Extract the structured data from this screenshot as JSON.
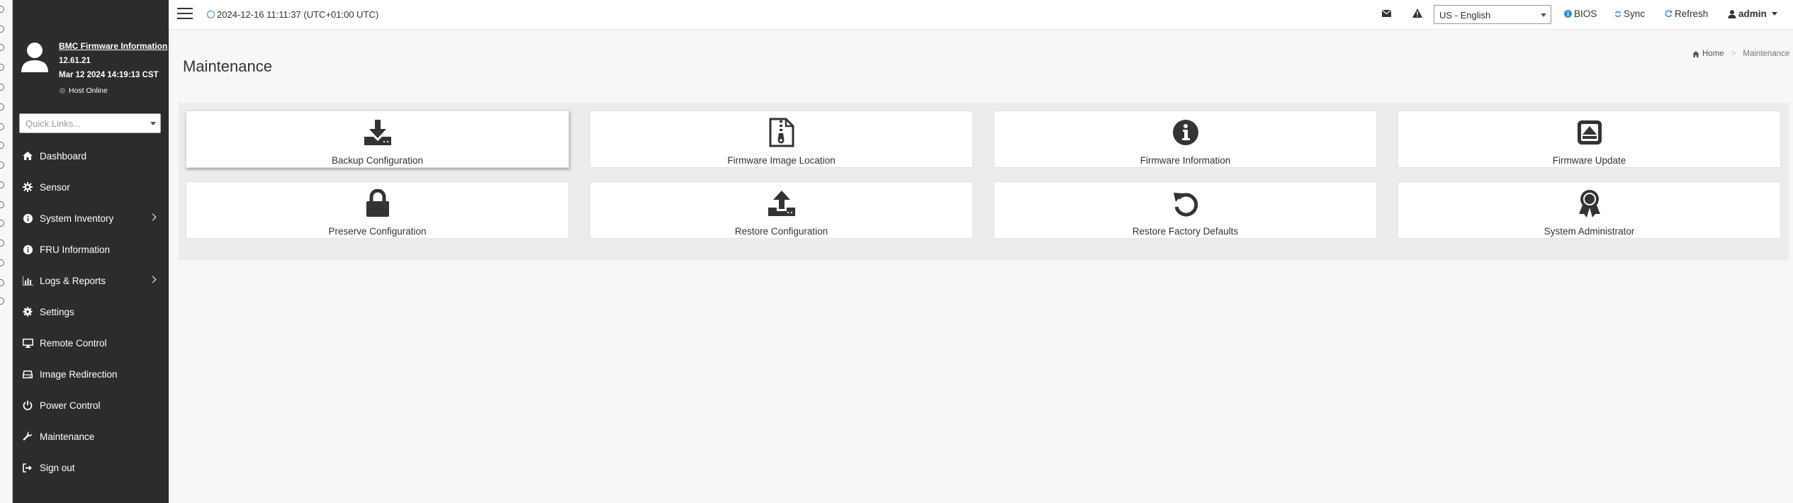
{
  "topbar": {
    "datetime": "2024-12-16 11:11:37 (UTC+01:00 UTC)",
    "language": "US - English",
    "bios_label": "BIOS",
    "sync_label": "Sync",
    "refresh_label": "Refresh",
    "user_label": "admin"
  },
  "sidebar": {
    "firmware_link": "BMC Firmware Information",
    "firmware_version": "12.61.21",
    "firmware_date": "Mar 12 2024 14:19:13 CST",
    "host_status": "Host Online",
    "quick_links_placeholder": "Quick Links...",
    "items": [
      {
        "label": "Dashboard",
        "icon": "dashboard-icon"
      },
      {
        "label": "Sensor",
        "icon": "sensor-icon"
      },
      {
        "label": "System Inventory",
        "icon": "info-icon",
        "has_submenu": true
      },
      {
        "label": "FRU Information",
        "icon": "info-icon"
      },
      {
        "label": "Logs & Reports",
        "icon": "bar-chart-icon",
        "has_submenu": true
      },
      {
        "label": "Settings",
        "icon": "gear-icon"
      },
      {
        "label": "Remote Control",
        "icon": "monitor-icon"
      },
      {
        "label": "Image Redirection",
        "icon": "drive-icon"
      },
      {
        "label": "Power Control",
        "icon": "power-icon"
      },
      {
        "label": "Maintenance",
        "icon": "wrench-icon"
      },
      {
        "label": "Sign out",
        "icon": "sign-out-icon"
      }
    ]
  },
  "page": {
    "title": "Maintenance",
    "breadcrumb": {
      "home": "Home",
      "current": "Maintenance"
    }
  },
  "cards": [
    {
      "label": "Backup Configuration",
      "icon": "download-icon"
    },
    {
      "label": "Firmware Image Location",
      "icon": "zip-file-icon"
    },
    {
      "label": "Firmware Information",
      "icon": "info-circle-icon"
    },
    {
      "label": "Firmware Update",
      "icon": "eject-icon"
    },
    {
      "label": "Preserve Configuration",
      "icon": "lock-icon"
    },
    {
      "label": "Restore Configuration",
      "icon": "upload-icon"
    },
    {
      "label": "Restore Factory Defaults",
      "icon": "undo-icon"
    },
    {
      "label": "System Administrator",
      "icon": "award-icon"
    }
  ],
  "colors": {
    "sidebar_bg": "#2c2c2c",
    "page_bg": "#f7f7f7",
    "accent_blue": "#3a8bd6"
  }
}
